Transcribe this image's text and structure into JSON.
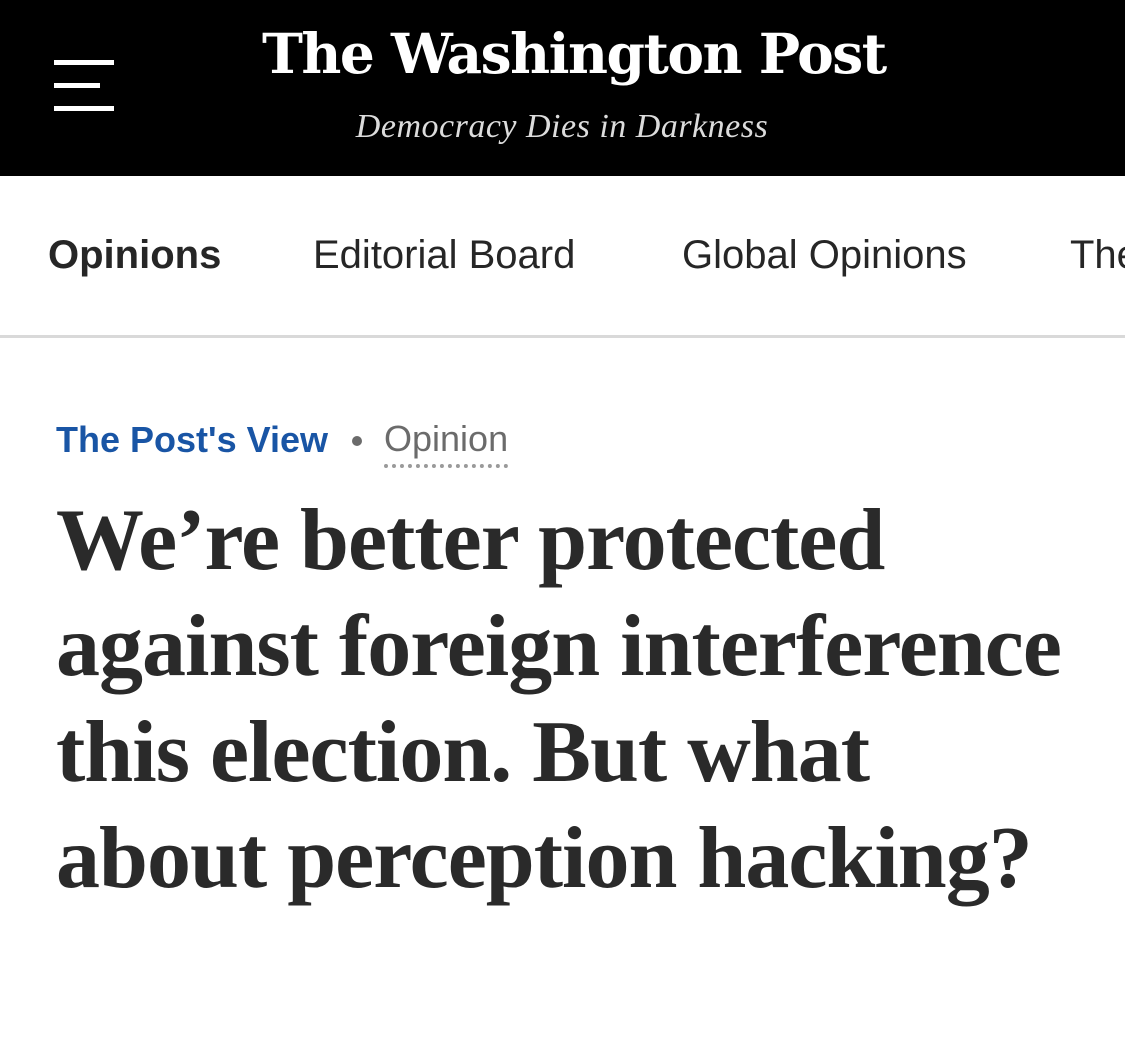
{
  "masthead": {
    "brand": "The Washington Post",
    "tagline": "Democracy Dies in Darkness",
    "menu_icon": "hamburger-menu-icon",
    "background_color": "#000000"
  },
  "nav": {
    "items": [
      {
        "label": "Opinions",
        "active": true
      },
      {
        "label": "Editorial Board",
        "active": false
      },
      {
        "label": "Global Opinions",
        "active": false
      },
      {
        "label": "The",
        "active": false
      }
    ]
  },
  "article": {
    "section": "The Post's View",
    "label": "Opinion",
    "headline": "We’re better protected against foreign interference this election. But what about perception hacking?",
    "section_color": "#1955a5"
  }
}
